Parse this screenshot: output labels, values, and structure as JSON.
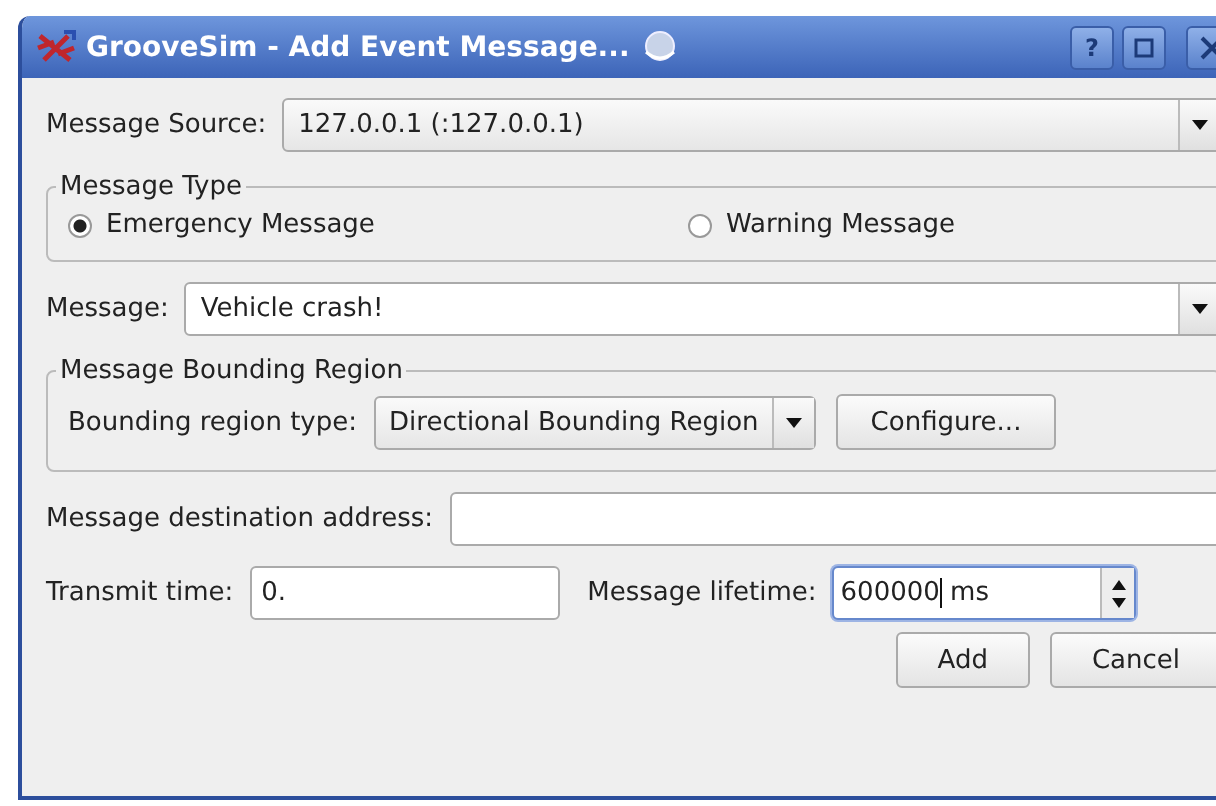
{
  "window": {
    "title": "GrooveSim - Add Event Message...",
    "buttons": [
      {
        "kind": "help",
        "label": "?"
      },
      {
        "kind": "maximize"
      },
      {
        "kind": "close"
      }
    ]
  },
  "message_source": {
    "label": "Message Source:",
    "value": "127.0.0.1 (:127.0.0.1)"
  },
  "message_type": {
    "title": "Message Type",
    "options": [
      {
        "label": "Emergency Message",
        "selected": true
      },
      {
        "label": "Warning Message",
        "selected": false
      }
    ]
  },
  "message": {
    "label": "Message:",
    "value": "Vehicle crash!"
  },
  "bounding_region": {
    "title": "Message Bounding Region",
    "label": "Bounding region type:",
    "value": "Directional Bounding Region",
    "button": "Configure..."
  },
  "destination": {
    "label": "Message destination address:"
  },
  "transmit_time": {
    "label": "Transmit time:",
    "value": "0."
  },
  "lifetime": {
    "label": "Message lifetime:",
    "value": "600000",
    "suffix": "ms",
    "focused": true
  },
  "buttons": [
    "Add",
    "Cancel"
  ]
}
